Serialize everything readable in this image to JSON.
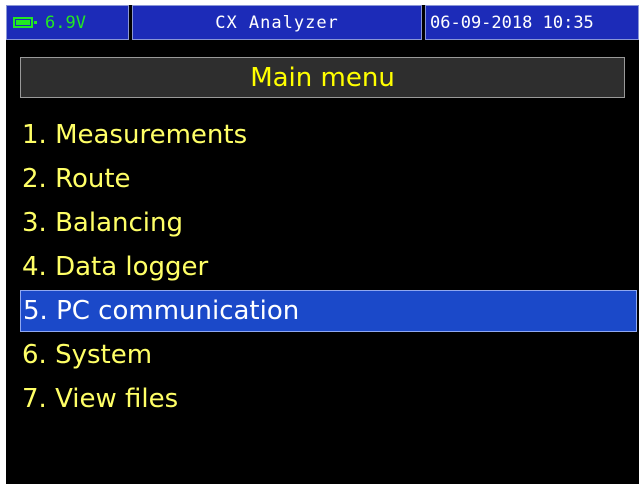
{
  "status": {
    "battery_voltage": "6.9V",
    "app_title": "CX Analyzer",
    "date": "06-09-2018",
    "time": "10:35"
  },
  "header": {
    "title": "Main menu"
  },
  "menu": {
    "items": [
      {
        "label": "1. Measurements"
      },
      {
        "label": "2. Route"
      },
      {
        "label": "3. Balancing"
      },
      {
        "label": "4. Data logger"
      },
      {
        "label": "5. PC communication",
        "selected": true
      },
      {
        "label": "6. System"
      },
      {
        "label": "7. View files"
      }
    ]
  },
  "colors": {
    "background": "#000000",
    "status_bar": "#1c2bb8",
    "battery": "#22e822",
    "header_text": "#ffff00",
    "menu_text": "#ffff66",
    "selection": "#1b49c9"
  }
}
